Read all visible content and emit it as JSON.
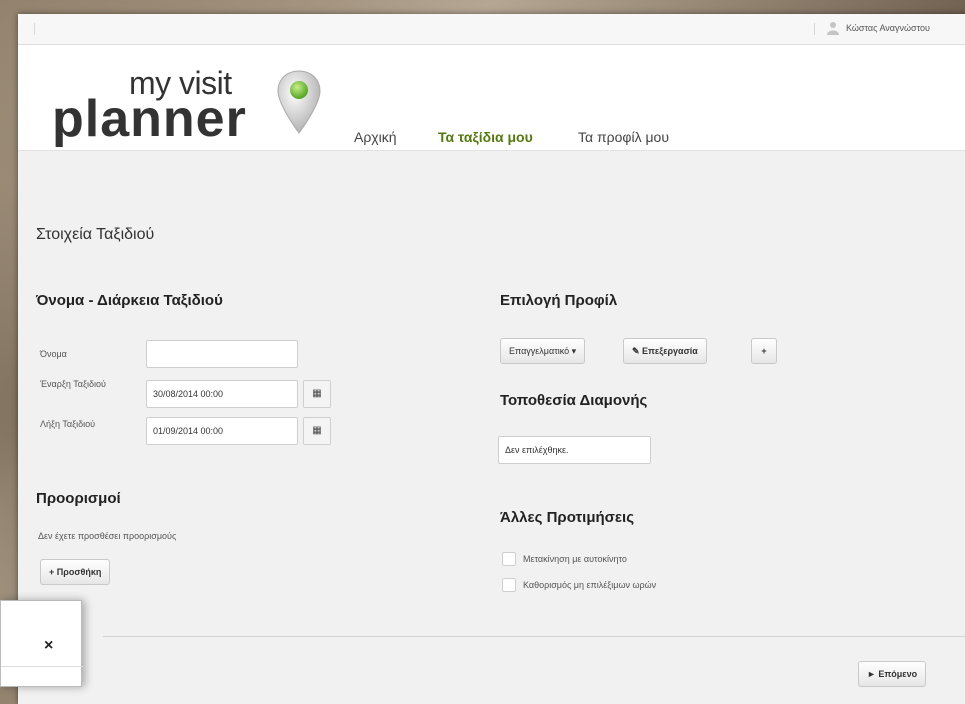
{
  "topbar": {
    "user": "Κώστας Αναγνώστου"
  },
  "logo": {
    "line1": "my visit",
    "line2": "planner"
  },
  "nav": {
    "items": [
      "Αρχική",
      "Τα ταξίδια μου",
      "Τα προφίλ μου"
    ],
    "active": "Τα ταξίδια μου"
  },
  "page_title": "Στοιχεία Ταξιδιού",
  "trip": {
    "heading": "Όνομα - Διάρκεια Ταξιδιού",
    "name_label": "Όνομα",
    "name_value": "",
    "start_label": "Έναρξη Ταξιδιού",
    "start_value": "30/08/2014 00:00",
    "end_label": "Λήξη Ταξιδιού",
    "end_value": "01/09/2014 00:00"
  },
  "destinations": {
    "heading": "Προορισμοί",
    "empty_text": "Δεν έχετε προσθέσει προορισμούς",
    "add_button": "+ Προσθήκη"
  },
  "profile": {
    "heading": "Επιλογή Προφίλ",
    "selected": "Επαγγελματικό",
    "edit_button": "✎ Επεξεργασία",
    "add_button": "+"
  },
  "accommodation": {
    "heading": "Τοποθεσία Διαμονής",
    "value": "Δεν επιλέχθηκε."
  },
  "preferences": {
    "heading": "Άλλες Προτιμήσεις",
    "options": [
      "Μετακίνηση με αυτοκίνητο",
      "Καθορισμός μη επιλέξιμων ωρών"
    ]
  },
  "footer": {
    "next_button": "► Επόμενο"
  },
  "modal": {
    "close": "×"
  },
  "colors": {
    "accent": "#557a10",
    "pin_green": "#7cc242"
  }
}
